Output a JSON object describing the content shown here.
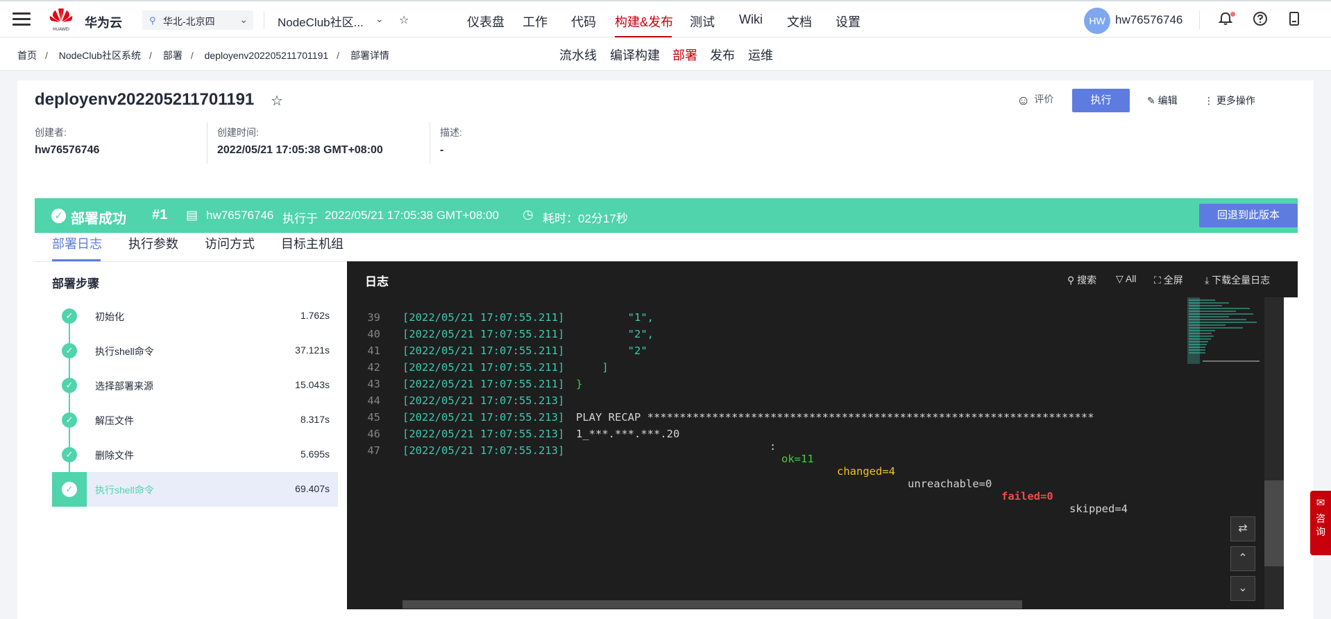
{
  "brand": {
    "name": "华为云",
    "logo_text": "HUAWEI"
  },
  "region": {
    "label": "华北-北京四"
  },
  "project": {
    "name": "NodeClub社区..."
  },
  "main_nav": [
    "仪表盘",
    "工作",
    "代码",
    "构建&发布",
    "测试",
    "Wiki",
    "文档",
    "设置"
  ],
  "main_nav_active": "构建&发布",
  "user": {
    "avatar_initials": "HW",
    "name": "hw76576746"
  },
  "breadcrumb": [
    "首页",
    "NodeClub社区系统",
    "部署",
    "deployenv202205211701191",
    "部署详情"
  ],
  "sub_nav": [
    "流水线",
    "编译构建",
    "部署",
    "发布",
    "运维"
  ],
  "sub_nav_active": "部署",
  "detail": {
    "title": "deployenv202205211701191",
    "rate_label": "评价",
    "execute_label": "执行",
    "edit_label": "编辑",
    "more_label": "更多操作",
    "creator_label": "创建者:",
    "creator_value": "hw76576746",
    "created_label": "创建时间:",
    "created_value": "2022/05/21 17:05:38 GMT+08:00",
    "desc_label": "描述:",
    "desc_value": "-"
  },
  "banner": {
    "status": "部署成功",
    "run_number": "#1",
    "executor": "hw76576746",
    "executed_at_label": "执行于",
    "executed_at": "2022/05/21 17:05:38 GMT+08:00",
    "duration": "耗时：02分17秒",
    "rollback_label": "回退到此版本",
    "color": "#50d4ab"
  },
  "tabs": [
    "部署日志",
    "执行参数",
    "访问方式",
    "目标主机组"
  ],
  "tabs_active": "部署日志",
  "steps": {
    "title": "部署步骤",
    "items": [
      {
        "name": "初始化",
        "time": "1.762s"
      },
      {
        "name": "执行shell命令",
        "time": "37.121s"
      },
      {
        "name": "选择部署来源",
        "time": "15.043s"
      },
      {
        "name": "解压文件",
        "time": "8.317s"
      },
      {
        "name": "删除文件",
        "time": "5.695s"
      },
      {
        "name": "执行shell命令",
        "time": "69.407s"
      }
    ],
    "active_index": 5
  },
  "log": {
    "title": "日志",
    "actions": {
      "search": "搜索",
      "filter": "All",
      "fullscreen": "全屏",
      "download": "下载全量日志"
    },
    "lines": [
      {
        "no": "39",
        "ts": "[2022/05/21 17:07:55.211]",
        "text": "        \"1\","
      },
      {
        "no": "40",
        "ts": "[2022/05/21 17:07:55.211]",
        "text": "        \"2\","
      },
      {
        "no": "41",
        "ts": "[2022/05/21 17:07:55.211]",
        "text": "        \"2\""
      },
      {
        "no": "42",
        "ts": "[2022/05/21 17:07:55.211]",
        "text": "    ]"
      },
      {
        "no": "43",
        "ts": "[2022/05/21 17:07:55.211]",
        "text": "}"
      },
      {
        "no": "44",
        "ts": "[2022/05/21 17:07:55.213]",
        "text": ""
      },
      {
        "no": "45",
        "ts": "[2022/05/21 17:07:55.213]",
        "text": "PLAY RECAP *********************************************************************"
      },
      {
        "no": "46",
        "ts": "[2022/05/21 17:07:55.213]",
        "text": "1_***.***.***.20"
      },
      {
        "no": "47",
        "ts": "[2022/05/21 17:07:55.213]",
        "text": ""
      }
    ],
    "recap": {
      "sep": ": ",
      "ok": "ok=11",
      "changed": "changed=4",
      "unreachable": "unreachable=0",
      "failed": "failed=0",
      "skipped": "skipped=4"
    },
    "colors": {
      "timestamp": "#3dc9b0",
      "ok": "#3fd13f",
      "changed": "#f0c419",
      "failed": "#f14c4c",
      "bracket": "#3fd13f"
    }
  },
  "consult": {
    "label": "咨询"
  }
}
